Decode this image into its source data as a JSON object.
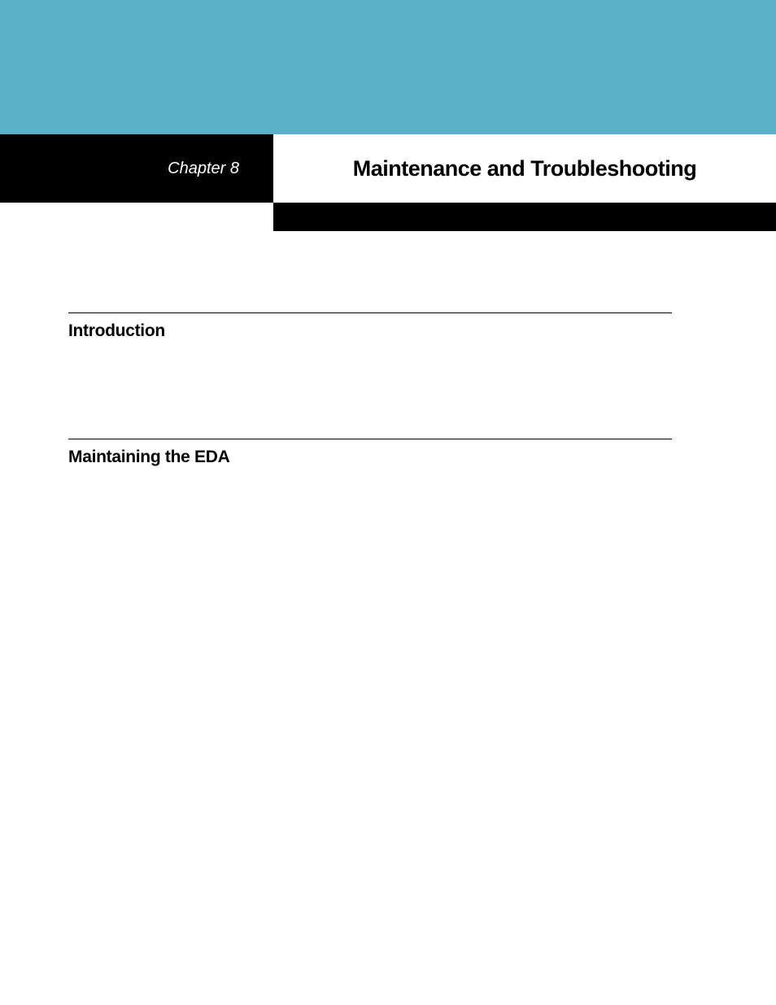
{
  "header": {
    "chapter_label": "Chapter 8",
    "title": "Maintenance and Troubleshooting"
  },
  "sections": {
    "intro_heading": "Introduction",
    "maintaining_heading": "Maintaining the EDA"
  }
}
